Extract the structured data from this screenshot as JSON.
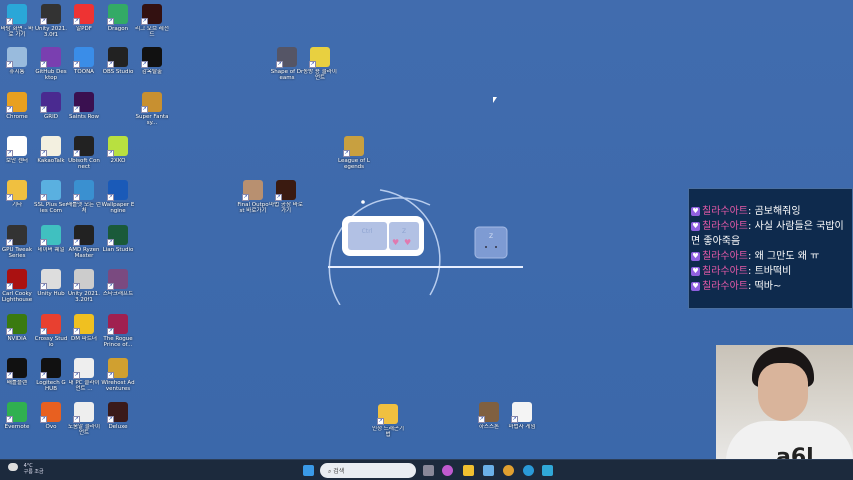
{
  "desktop_icons": [
    {
      "label": "바탕 화면 - 바로 가기",
      "color": "#2aa7d8"
    },
    {
      "label": "Unity 2021.3.0f1",
      "color": "#333"
    },
    {
      "label": "알PDF",
      "color": "#e33"
    },
    {
      "label": "Dragon",
      "color": "#3a6"
    },
    {
      "label": "리그 오브 레전드",
      "color": "#311"
    },
    {
      "label": "휴지통",
      "color": "#9bd"
    },
    {
      "label": "GitHub Desktop",
      "color": "#7a3fb0"
    },
    {
      "label": "TOONA",
      "color": "#3a8de8"
    },
    {
      "label": "OBS Studio",
      "color": "#222"
    },
    {
      "label": "감옥탈출",
      "color": "#111"
    },
    {
      "label": "Chrome",
      "color": "#e8a020"
    },
    {
      "label": "GRID",
      "color": "#4a2a90"
    },
    {
      "label": "Saints Row",
      "color": "#3a1050"
    },
    {
      "label": "Super Fantasy...",
      "color": "#c89030"
    },
    {
      "label": "보안 센터",
      "color": "#fff"
    },
    {
      "label": "KakaoTalk",
      "color": "#f3f0e0"
    },
    {
      "label": "Ubisoft Connect",
      "color": "#222"
    },
    {
      "label": "2XKO",
      "color": "#b8e040"
    },
    {
      "label": "기타",
      "color": "#f0c040"
    },
    {
      "label": "SSL Plus Series Com",
      "color": "#5ab0e0"
    },
    {
      "label": "배틀넷 모든 런처",
      "color": "#3a90d0"
    },
    {
      "label": "Wallpaper Engine",
      "color": "#1a5ab8"
    },
    {
      "label": "GPU Tweak Series",
      "color": "#333"
    },
    {
      "label": "네이버 웨일",
      "color": "#40c0c0"
    },
    {
      "label": "AMD Ryzen Master",
      "color": "#222"
    },
    {
      "label": "Lian Studio",
      "color": "#1a5a3a"
    },
    {
      "label": "Carl Cooky Lighthouse",
      "color": "#a11"
    },
    {
      "label": "Unity Hub",
      "color": "#ddd"
    },
    {
      "label": "Unity 2021.3.20f1",
      "color": "#ccc"
    },
    {
      "label": "스타크래프트",
      "color": "#7a4a80"
    },
    {
      "label": "NVIDIA",
      "color": "#3a7a10"
    },
    {
      "label": "Crossy Studio",
      "color": "#e84030"
    },
    {
      "label": "DM 파트너",
      "color": "#f0c020"
    },
    {
      "label": "The Rogue Prince of...",
      "color": "#a02050"
    },
    {
      "label": "배틀플랜",
      "color": "#111"
    },
    {
      "label": "Logitech G HUB",
      "color": "#111"
    },
    {
      "label": "내 PC 클라이언트 ...",
      "color": "#eee"
    },
    {
      "label": "Wirehost Adventures",
      "color": "#d0a030"
    },
    {
      "label": "Evernote",
      "color": "#30b050"
    },
    {
      "label": "Ovo",
      "color": "#e86020"
    },
    {
      "label": "도움말 클라이언트",
      "color": "#eee"
    },
    {
      "label": "Deluxe",
      "color": "#3a1a1a"
    },
    {
      "label": "Shape of Dreams",
      "color": "#556"
    },
    {
      "label": "동방 용 클라이언트",
      "color": "#e8d040"
    },
    {
      "label": "League of Legends",
      "color": "#c8a040"
    },
    {
      "label": "Final Outpost 바로가기",
      "color": "#b89070"
    },
    {
      "label": "마법 공장 바로가기",
      "color": "#3a1a10"
    },
    {
      "label": "인정 드래곤기법",
      "color": "#f0c040"
    },
    {
      "label": "하스스톤",
      "color": "#806040"
    },
    {
      "label": "마법사 게임",
      "color": "#f4f4f4"
    }
  ],
  "keys": {
    "ctrl": "Ctrl",
    "z": "Z",
    "z2": "Z"
  },
  "chat": {
    "messages": [
      {
        "user": "칠라수아트",
        "sep": ":",
        "text": "곰보해줘잉"
      },
      {
        "user": "칠라수아트",
        "sep": ":",
        "text": "사실 사람들은 국밥이면 좋아죽음"
      },
      {
        "user": "칠라수아트",
        "sep": ":",
        "text": "왜 그만도 왜 ㅠ"
      },
      {
        "user": "칠라수아트",
        "sep": ":",
        "text": "트바떡비"
      },
      {
        "user": "칠라수아트",
        "sep": ":",
        "text": "떡바~"
      }
    ],
    "badge_color": "#9060e0",
    "user_color": "#e65aa8"
  },
  "taskbar": {
    "weather_temp": "4°C",
    "weather_desc": "구름 조금",
    "search_placeholder": "검색",
    "apps": [
      "task-view",
      "copilot",
      "file-explorer",
      "vs-code",
      "chrome",
      "edge",
      "bluesky"
    ]
  }
}
